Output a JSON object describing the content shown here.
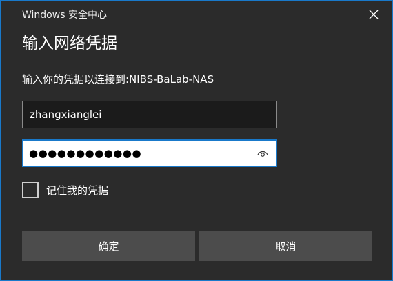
{
  "window": {
    "title": "Windows 安全中心",
    "close_icon": "close-icon"
  },
  "dialog": {
    "heading": "输入网络凭据",
    "prompt": "输入你的凭据以连接到:NIBS-BaLab-NAS"
  },
  "form": {
    "username_value": "zhangxianglei",
    "password_masked": "●●●●●●●●●●●●",
    "reveal_icon": "eye-icon",
    "remember_checked": false,
    "remember_label": "记住我的凭据"
  },
  "buttons": {
    "ok_label": "确定",
    "cancel_label": "取消"
  },
  "colors": {
    "background": "#2b2b2b",
    "accent": "#1979ca",
    "button": "#4c4c4c",
    "input_dark": "#1b1b1b"
  }
}
